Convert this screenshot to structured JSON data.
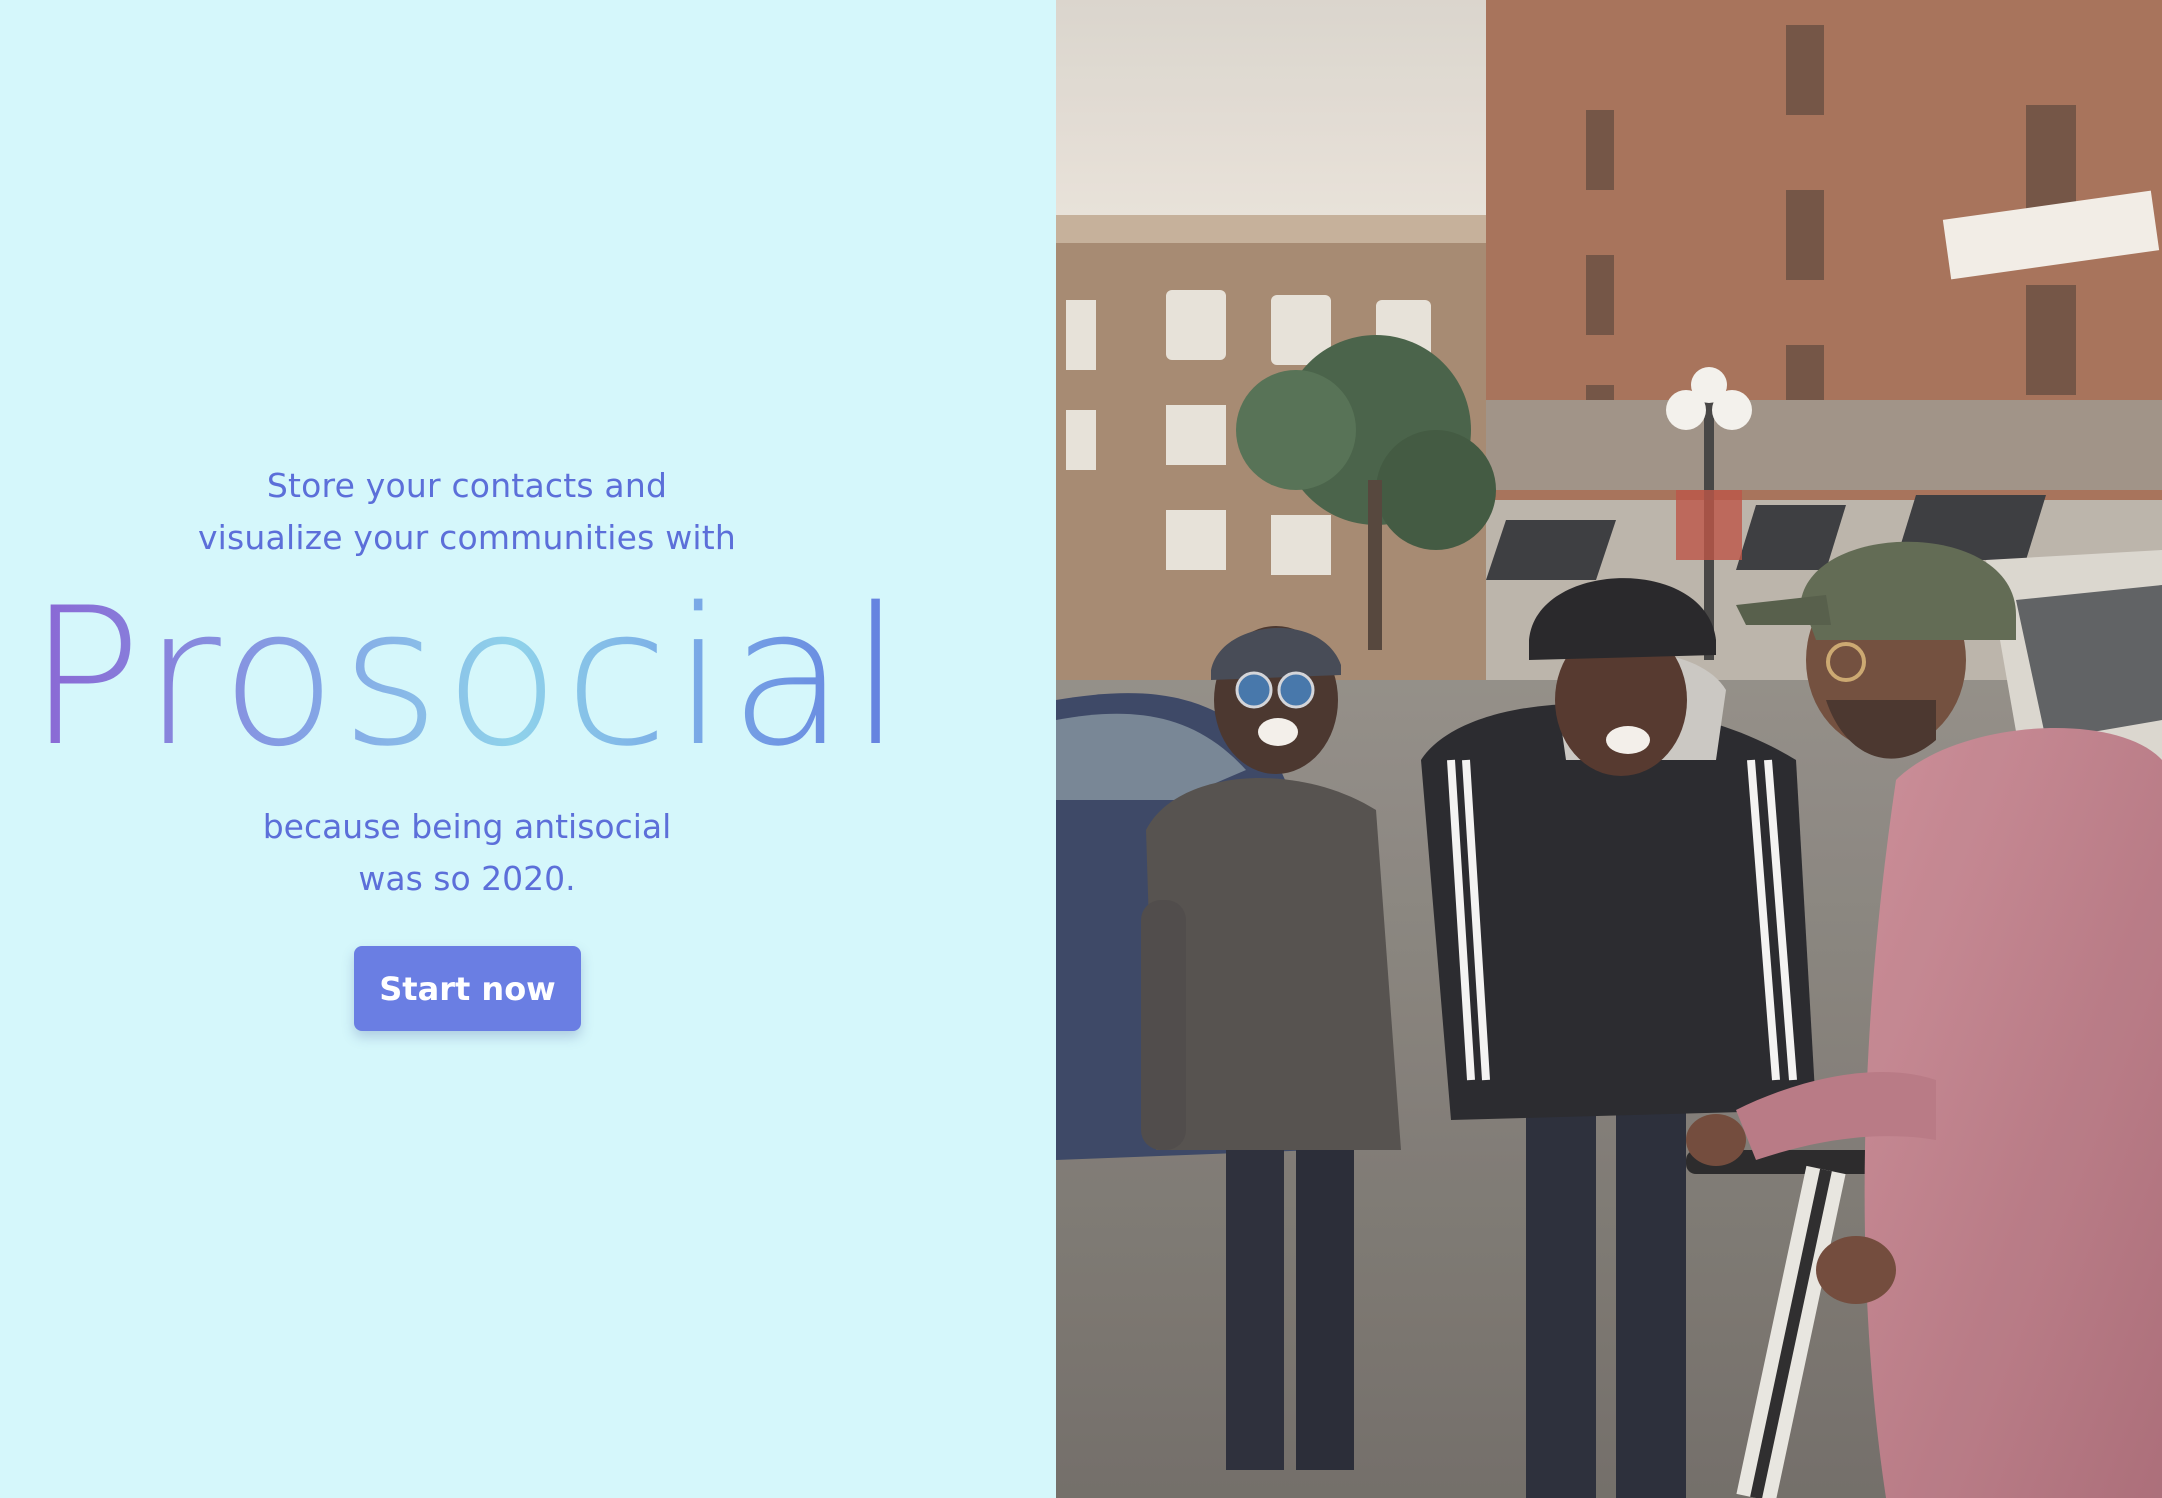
{
  "hero": {
    "tagline_line1": "Store your contacts and",
    "tagline_line2": "visualize your communities with",
    "brand": "Prosocial",
    "subline_line1": "because being antisocial",
    "subline_line2": "was so 2020.",
    "cta_label": "Start now"
  },
  "colors": {
    "background": "#d5f7fb",
    "text_accent": "#5c6fd9",
    "button": "#6a7ee3",
    "gradient_start": "#8b5fd2",
    "gradient_mid": "#8fd2ea",
    "gradient_end": "#5f78de"
  }
}
